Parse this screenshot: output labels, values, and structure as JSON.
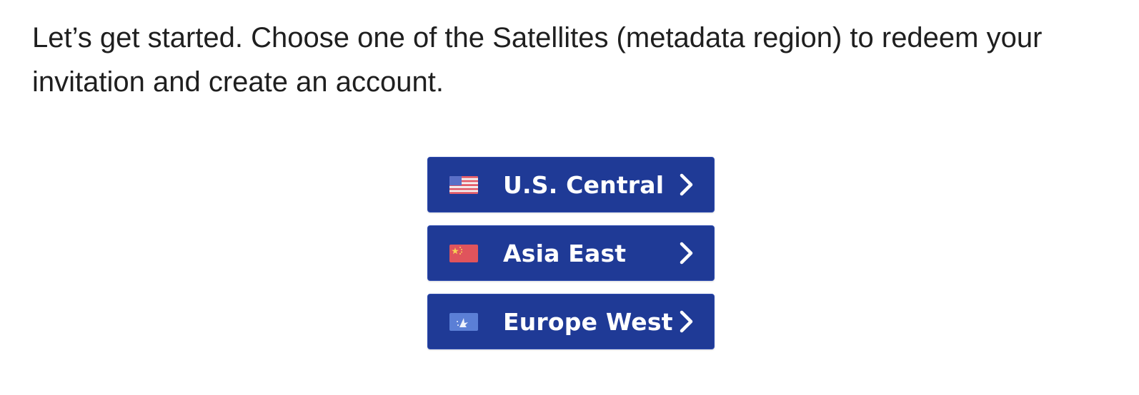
{
  "intro": {
    "text": "Let’s get started. Choose one of the Satellites (metadata region) to redeem your invitation and create an account."
  },
  "regions": [
    {
      "label": "U.S. Central",
      "flag_icon": "us-flag-icon",
      "arrow_icon": "chevron-right-icon"
    },
    {
      "label": "Asia East",
      "flag_icon": "china-flag-icon",
      "arrow_icon": "chevron-right-icon"
    },
    {
      "label": "Europe West",
      "flag_icon": "eu-flag-icon",
      "arrow_icon": "chevron-right-icon"
    }
  ],
  "colors": {
    "button_bg": "#1f3a96",
    "button_text": "#ffffff",
    "body_text": "#1f1f1f"
  }
}
